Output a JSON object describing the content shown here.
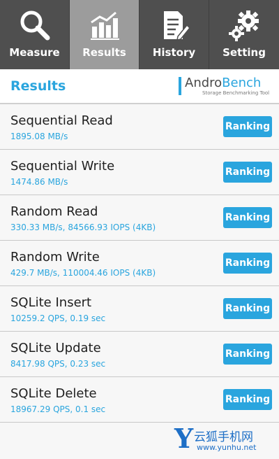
{
  "tabs": [
    {
      "label": "Measure",
      "icon": "magnifier-icon"
    },
    {
      "label": "Results",
      "icon": "bar-chart-icon",
      "active": true
    },
    {
      "label": "History",
      "icon": "document-pen-icon"
    },
    {
      "label": "Setting",
      "icon": "gears-icon"
    }
  ],
  "header": {
    "title": "Results",
    "logo_a": "Andro",
    "logo_b": "Bench",
    "logo_sub": "Storage Benchmarking Tool"
  },
  "ranking_label": "Ranking",
  "results": [
    {
      "name": "Sequential Read",
      "value": "1895.08 MB/s"
    },
    {
      "name": "Sequential Write",
      "value": "1474.86 MB/s"
    },
    {
      "name": "Random Read",
      "value": "330.33 MB/s, 84566.93 IOPS (4KB)"
    },
    {
      "name": "Random Write",
      "value": "429.7 MB/s, 110004.46 IOPS (4KB)"
    },
    {
      "name": "SQLite Insert",
      "value": "10259.2 QPS, 0.19 sec"
    },
    {
      "name": "SQLite Update",
      "value": "8417.98 QPS, 0.23 sec"
    },
    {
      "name": "SQLite Delete",
      "value": "18967.29 QPS, 0.1 sec"
    }
  ],
  "watermark": {
    "letter": "Y",
    "cn": "云狐手机网",
    "url": "www.yunhu.net"
  },
  "colors": {
    "accent": "#2aa5de",
    "tabbar": "#4f4f4f",
    "tab_active": "#9c9c9c"
  }
}
